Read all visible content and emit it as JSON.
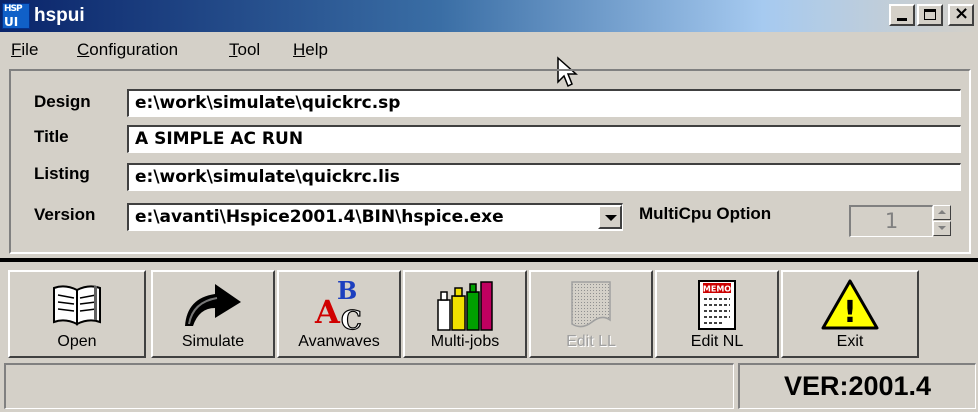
{
  "window": {
    "title": "hspui",
    "icon_top": "HSP",
    "icon_bottom": "UI",
    "icon": "hspui-app-icon"
  },
  "menu": [
    {
      "label": "File",
      "mnemonic": "F",
      "rest": "ile"
    },
    {
      "label": "Configuration",
      "mnemonic": "C",
      "rest": "onfiguration"
    },
    {
      "label": "Tool",
      "mnemonic": "T",
      "rest": "ool"
    },
    {
      "label": "Help",
      "mnemonic": "H",
      "rest": "elp"
    }
  ],
  "form": {
    "design_label": "Design",
    "design_value": "e:\\work\\simulate\\quickrc.sp",
    "title_label": "Title",
    "title_value": "A SIMPLE AC RUN",
    "listing_label": "Listing",
    "listing_value": "e:\\work\\simulate\\quickrc.lis",
    "version_label": "Version",
    "version_value": "e:\\avanti\\Hspice2001.4\\BIN\\hspice.exe",
    "multicpu_label": "MultiCpu Option",
    "multicpu_value": "1"
  },
  "toolbar": [
    {
      "label": "Open",
      "icon": "open-book-icon",
      "enabled": true
    },
    {
      "label": "Simulate",
      "icon": "curved-arrow-icon",
      "enabled": true
    },
    {
      "label": "Avanwaves",
      "icon": "abc-letters-icon",
      "enabled": true
    },
    {
      "label": "Multi-jobs",
      "icon": "bottles-icon",
      "enabled": true
    },
    {
      "label": "Edit LL",
      "icon": "document-icon",
      "enabled": false
    },
    {
      "label": "Edit NL",
      "icon": "memo-icon",
      "enabled": true,
      "icon_text": "MEMO"
    },
    {
      "label": "Exit",
      "icon": "warning-icon",
      "enabled": true,
      "icon_text": "!"
    }
  ],
  "status": {
    "message": "",
    "version": "VER:2001.4"
  },
  "colors": {
    "title_active": "#0a246a",
    "face": "#d4d0c8",
    "warning_yellow": "#ffff00",
    "memo_red": "#cc0000"
  }
}
